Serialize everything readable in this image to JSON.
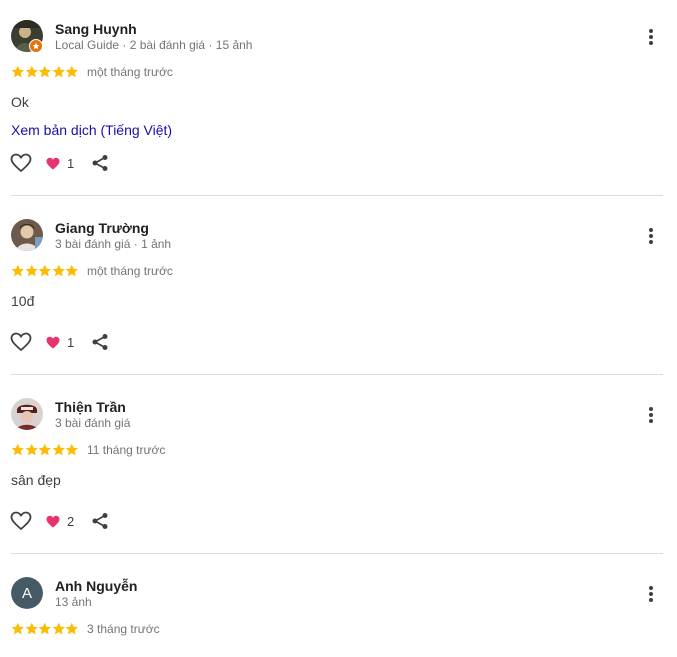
{
  "colors": {
    "star": "#fbbc04",
    "link": "#1a0dab",
    "heart": "#e8336d",
    "meta": "#70757a"
  },
  "reviews": [
    {
      "author": "Sang Huynh",
      "meta": "Local Guide · 2 bài đánh giá · 15 ảnh",
      "rating": 5,
      "time": "một tháng trước",
      "text": "Ok",
      "translate": "Xem bản dịch (Tiếng Việt)",
      "reactions": "1",
      "avatar": "local-guide-photo"
    },
    {
      "author": "Giang Trường",
      "meta": "3 bài đánh giá · 1 ảnh",
      "rating": 5,
      "time": "một tháng trước",
      "text": "10đ",
      "reactions": "1",
      "avatar": "user-photo"
    },
    {
      "author": "Thiện Trần",
      "meta": "3 bài đánh giá",
      "rating": 5,
      "time": "11 tháng trước",
      "text": "sân đẹp",
      "reactions": "2",
      "avatar": "user-photo"
    },
    {
      "author": "Anh Nguyễn",
      "meta": "13 ảnh",
      "rating": 5,
      "time": "3 tháng trước",
      "avatar_initial": "A",
      "avatar": "initial-letter"
    }
  ]
}
